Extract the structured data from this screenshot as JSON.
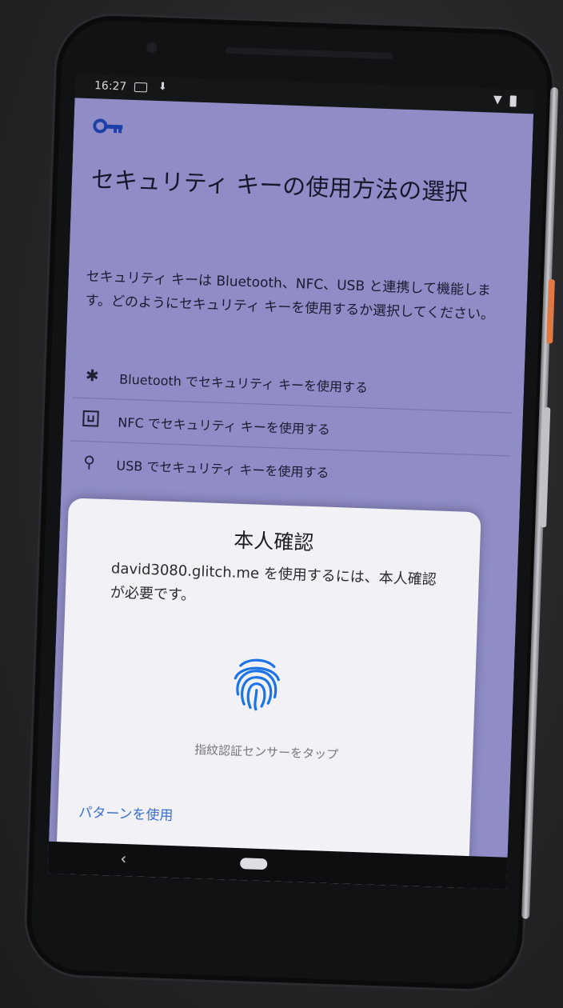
{
  "statusbar": {
    "time": "16:27",
    "mail_icon": "mail-icon",
    "download_icon": "download-icon",
    "download_glyph": "⬇",
    "wifi_icon": "wifi-icon",
    "wifi_glyph": "▼",
    "battery_icon": "battery-icon"
  },
  "app": {
    "icon": "key-icon",
    "title": "セキュリティ キーの使用方法の選択",
    "description": "セキュリティ キーは Bluetooth、NFC、USB と連携して機能します。どのようにセキュリティ キーを使用するか選択してください。",
    "options": [
      {
        "icon": "bluetooth-icon",
        "glyph": "✱",
        "label": "Bluetooth でセキュリティ キーを使用する"
      },
      {
        "icon": "nfc-icon",
        "glyph": "",
        "label": "NFC でセキュリティ キーを使用する"
      },
      {
        "icon": "usb-icon",
        "glyph": "⚲",
        "label": "USB でセキュリティ キーを使用する"
      }
    ]
  },
  "dialog": {
    "title": "本人確認",
    "subtitle": "david3080.glitch.me を使用するには、本人確認が必要です。",
    "fingerprint_icon": "fingerprint-icon",
    "hint": "指紋認証センサーをタップ",
    "pattern_link": "パターンを使用"
  },
  "navbar": {
    "back_icon": "back-icon",
    "back_glyph": "‹",
    "home_icon": "home-pill-icon"
  },
  "colors": {
    "app_background": "#8f8cc6",
    "dialog_background": "#f1f1f6",
    "accent": "#1a73e8",
    "link": "#3a6fd0"
  }
}
